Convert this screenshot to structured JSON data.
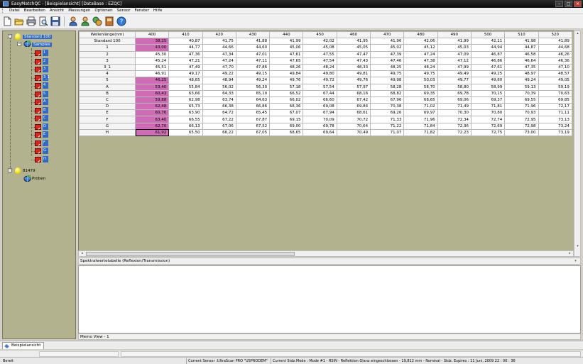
{
  "window": {
    "title": "EasyMatchQC - [Beispielansicht]   [DataBase : EZQC]",
    "minimize_glyph": "–",
    "maximize_glyph": "□",
    "close_glyph": "✕"
  },
  "menu": {
    "items": [
      "Datei",
      "Bearbeiten",
      "Ansicht",
      "Messungen",
      "Optionen",
      "Sensor",
      "Fenster",
      "Hilfe"
    ]
  },
  "toolbar": {
    "icons": [
      "new-document-icon",
      "open-folder-icon",
      "print-icon",
      "print-preview-icon",
      "save-icon",
      "standard-user-icon",
      "sample-user-icon",
      "color-tools-icon",
      "sensor-book-icon",
      "help-icon"
    ]
  },
  "tree": {
    "root1": {
      "label": "Standard 100",
      "expander": "−"
    },
    "samples": {
      "label": "Samples",
      "expander": "−"
    },
    "sample_items": [
      "1",
      "2",
      "3",
      "3_1",
      "4",
      "5",
      "A",
      "B",
      "C",
      "D",
      "E",
      "F",
      "G",
      "H"
    ],
    "root2": {
      "label": "81479",
      "expander": "−"
    },
    "proben": {
      "label": "Proben"
    }
  },
  "grid": {
    "header_label": "Wellenlänge(nm)",
    "wavelengths": [
      "400",
      "410",
      "420",
      "430",
      "440",
      "450",
      "460",
      "470",
      "480",
      "490",
      "500",
      "510",
      "520"
    ],
    "rows": [
      {
        "name": "Standard 100",
        "values": [
          "38,25",
          "40,87",
          "41,75",
          "41,88",
          "41,99",
          "42,02",
          "41,95",
          "41,96",
          "42,06",
          "41,99",
          "42,11",
          "41,98",
          "41,89"
        ],
        "highlight": true
      },
      {
        "name": "1",
        "values": [
          "43,00",
          "44,77",
          "44,66",
          "44,60",
          "45,06",
          "45,08",
          "45,05",
          "45,02",
          "45,12",
          "45,03",
          "44,94",
          "44,87",
          "44,68"
        ],
        "highlight": true
      },
      {
        "name": "2",
        "values": [
          "45,30",
          "47,36",
          "47,34",
          "47,01",
          "47,61",
          "47,55",
          "47,47",
          "47,39",
          "47,24",
          "47,09",
          "46,87",
          "46,58",
          "46,26"
        ],
        "highlight": false
      },
      {
        "name": "3",
        "values": [
          "45,24",
          "47,21",
          "47,24",
          "47,11",
          "47,65",
          "47,54",
          "47,43",
          "47,46",
          "47,38",
          "47,12",
          "46,86",
          "46,64",
          "46,36"
        ],
        "highlight": false
      },
      {
        "name": "3_1",
        "values": [
          "45,51",
          "47,49",
          "47,70",
          "47,86",
          "48,26",
          "48,24",
          "48,33",
          "48,25",
          "48,24",
          "47,99",
          "47,61",
          "47,35",
          "47,10"
        ],
        "highlight": false
      },
      {
        "name": "4",
        "values": [
          "46,91",
          "49,17",
          "49,22",
          "49,15",
          "49,84",
          "49,80",
          "49,81",
          "49,75",
          "49,75",
          "49,49",
          "49,25",
          "48,97",
          "48,57"
        ],
        "highlight": false
      },
      {
        "name": "5",
        "values": [
          "46,25",
          "48,65",
          "48,94",
          "49,24",
          "49,76",
          "49,72",
          "49,76",
          "49,98",
          "50,03",
          "49,77",
          "49,60",
          "49,24",
          "49,05"
        ],
        "highlight": true
      },
      {
        "name": "A",
        "values": [
          "53,40",
          "55,84",
          "56,02",
          "56,30",
          "57,18",
          "57,54",
          "57,97",
          "58,28",
          "58,70",
          "58,80",
          "58,99",
          "59,13",
          "59,19"
        ],
        "highlight": true
      },
      {
        "name": "B",
        "values": [
          "60,43",
          "63,66",
          "64,33",
          "65,10",
          "66,52",
          "67,44",
          "68,16",
          "68,82",
          "69,35",
          "69,78",
          "70,15",
          "70,39",
          "70,63"
        ],
        "highlight": true
      },
      {
        "name": "C",
        "values": [
          "59,88",
          "62,98",
          "63,74",
          "64,63",
          "66,02",
          "66,60",
          "67,42",
          "67,96",
          "68,65",
          "69,06",
          "69,37",
          "69,55",
          "69,85"
        ],
        "highlight": true
      },
      {
        "name": "D",
        "values": [
          "62,48",
          "65,73",
          "66,38",
          "66,86",
          "68,36",
          "69,08",
          "69,84",
          "70,38",
          "71,02",
          "71,49",
          "71,81",
          "71,96",
          "72,17"
        ],
        "highlight": true
      },
      {
        "name": "E",
        "values": [
          "60,76",
          "63,90",
          "64,72",
          "65,45",
          "67,07",
          "67,94",
          "68,61",
          "69,26",
          "69,97",
          "70,30",
          "70,80",
          "70,93",
          "71,11"
        ],
        "highlight": true
      },
      {
        "name": "F",
        "values": [
          "63,40",
          "66,55",
          "67,22",
          "67,87",
          "69,15",
          "70,09",
          "70,72",
          "71,33",
          "71,96",
          "72,34",
          "72,74",
          "72,95",
          "73,13"
        ],
        "highlight": true
      },
      {
        "name": "G",
        "values": [
          "62,70",
          "66,13",
          "67,06",
          "67,52",
          "69,00",
          "69,78",
          "70,64",
          "71,22",
          "71,84",
          "72,36",
          "72,69",
          "72,98",
          "73,24"
        ],
        "highlight": true
      },
      {
        "name": "H",
        "values": [
          "61,92",
          "65,50",
          "66,22",
          "67,05",
          "68,65",
          "69,64",
          "70,49",
          "71,07",
          "71,82",
          "72,23",
          "72,75",
          "73,00",
          "73,19"
        ],
        "highlight": true,
        "selected": true
      }
    ]
  },
  "scroll": {
    "left": "◂",
    "right": "▸",
    "up": "▴",
    "down": "▾"
  },
  "panels": {
    "spectral_title": "Spektralwertetabelle (Reflexion/Transmission)",
    "memo_title": "Memo View - 1"
  },
  "tabs": [
    {
      "label": "Beispielansicht"
    }
  ],
  "status": {
    "ready": "Bereit",
    "sensor": "Current Sensor :UltraScan PRO \"USPRODEM\"",
    "mode": "Current Stdz.Mode :  Mode #1 - RSIN - Reflektion Glanz eingeschlossen - 19,812 mm - Nominal - Stdz. Expires : 11 Juni, 2009 22 : 06 : 36"
  }
}
